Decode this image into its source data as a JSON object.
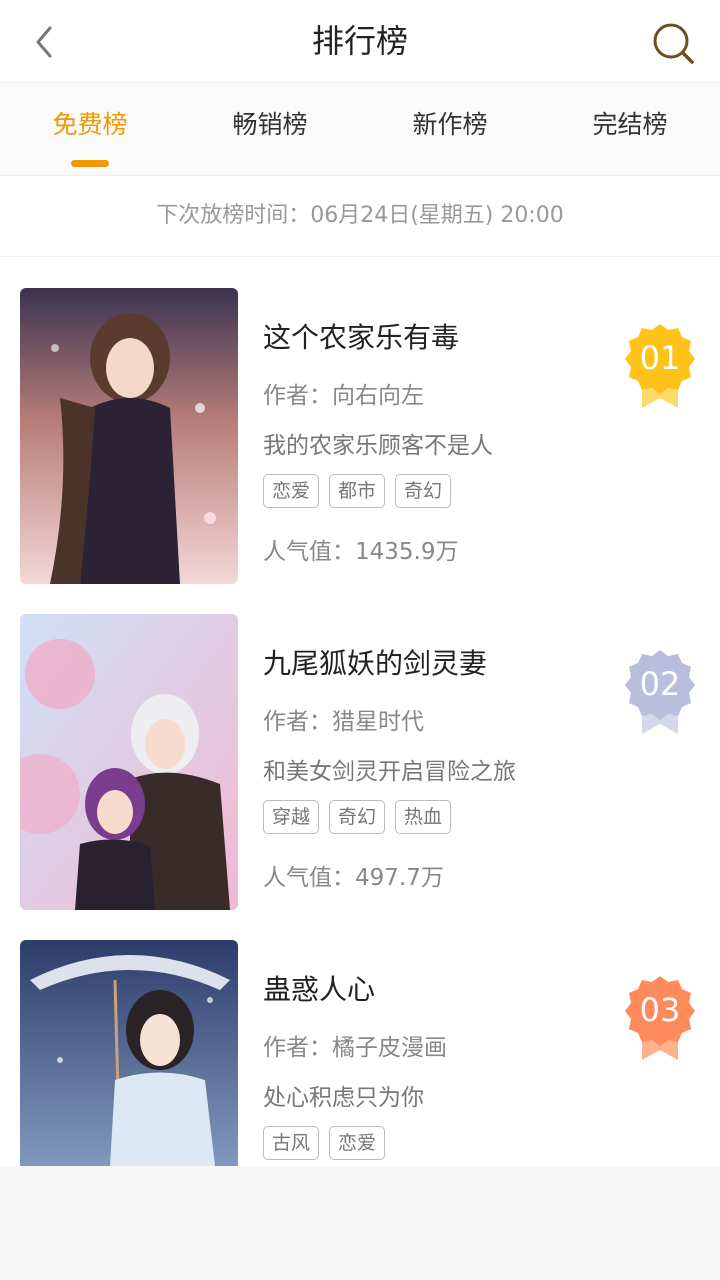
{
  "header": {
    "title": "排行榜"
  },
  "tabs": [
    {
      "label": "免费榜",
      "active": true
    },
    {
      "label": "畅销榜",
      "active": false
    },
    {
      "label": "新作榜",
      "active": false
    },
    {
      "label": "完结榜",
      "active": false
    }
  ],
  "notice": "下次放榜时间：06月24日(星期五) 20:00",
  "books": [
    {
      "rank": "01",
      "title": "这个农家乐有毒",
      "author": "作者：向右向左",
      "description": "我的农家乐顾客不是人",
      "tags": [
        "恋爱",
        "都市",
        "奇幻"
      ],
      "popularity": "人气值：1435.9万",
      "badge_color": "#ffc21a"
    },
    {
      "rank": "02",
      "title": "九尾狐妖的剑灵妻",
      "author": "作者：猎星时代",
      "description": "和美女剑灵开启冒险之旅",
      "tags": [
        "穿越",
        "奇幻",
        "热血"
      ],
      "popularity": "人气值：497.7万",
      "badge_color": "#b8bedc"
    },
    {
      "rank": "03",
      "title": "蛊惑人心",
      "author": "作者：橘子皮漫画",
      "description": "处心积虑只为你",
      "tags": [
        "古风",
        "恋爱"
      ],
      "popularity": "",
      "badge_color": "#ff8a5c"
    }
  ],
  "colors": {
    "accent": "#f39800"
  }
}
